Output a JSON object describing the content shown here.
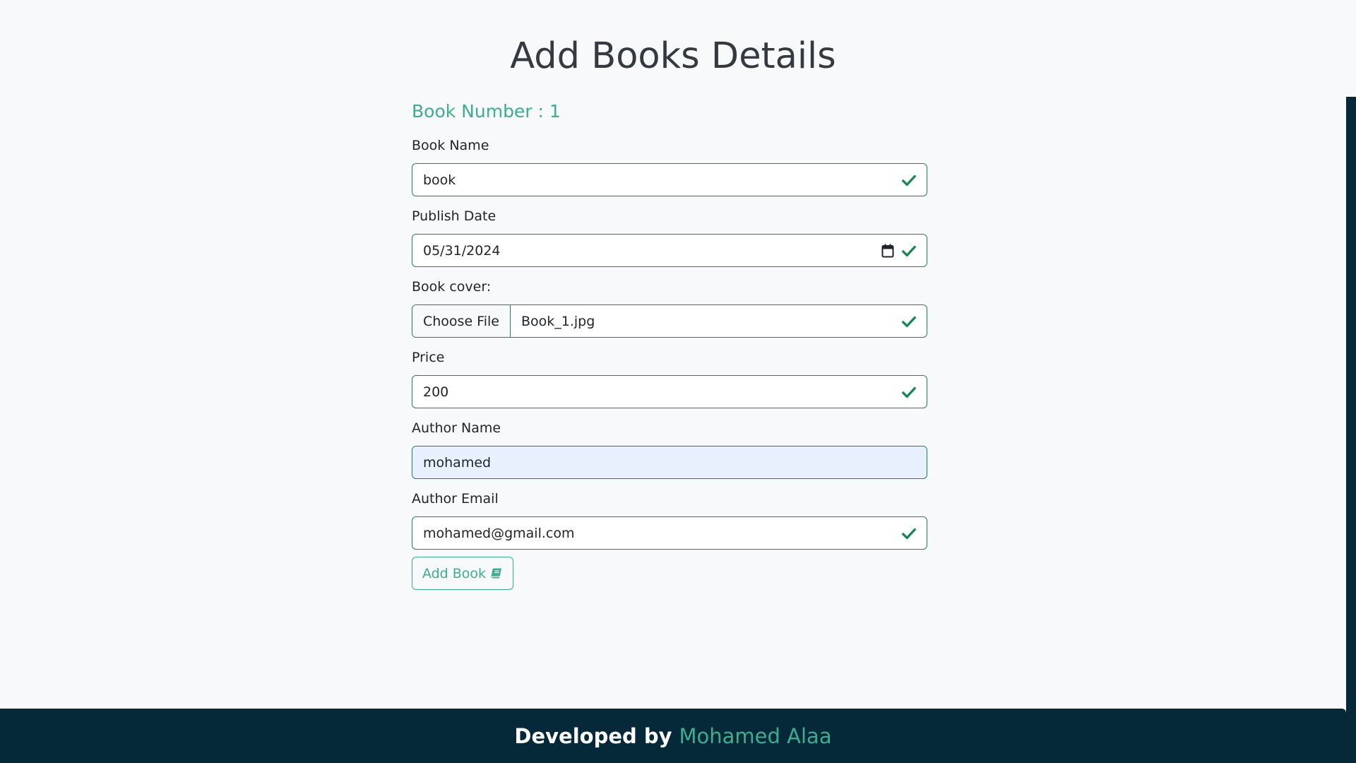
{
  "page": {
    "title": "Add Books Details"
  },
  "form": {
    "book_number_label": "Book Number : 1",
    "fields": {
      "book_name": {
        "label": "Book Name",
        "value": "book"
      },
      "publish_date": {
        "label": "Publish Date",
        "value": "05/31/2024"
      },
      "book_cover": {
        "label": "Book cover:",
        "button": "Choose File",
        "file_name": "Book_1.jpg"
      },
      "price": {
        "label": "Price",
        "value": "200"
      },
      "author_name": {
        "label": "Author Name",
        "value": "mohamed"
      },
      "author_email": {
        "label": "Author Email",
        "value": "mohamed@gmail.com"
      }
    },
    "submit_label": "Add Book",
    "icons": {
      "valid": "check-icon",
      "date_picker": "calendar-icon",
      "submit": "book-icon"
    }
  },
  "footer": {
    "prefix": "Developed by",
    "author": "Mohamed Alaa"
  },
  "colors": {
    "accent": "#3cad8f",
    "valid": "#198754",
    "footer_bg": "#06293a",
    "page_bg": "#f8f9fa",
    "autofill_bg": "#e8f0fe"
  }
}
